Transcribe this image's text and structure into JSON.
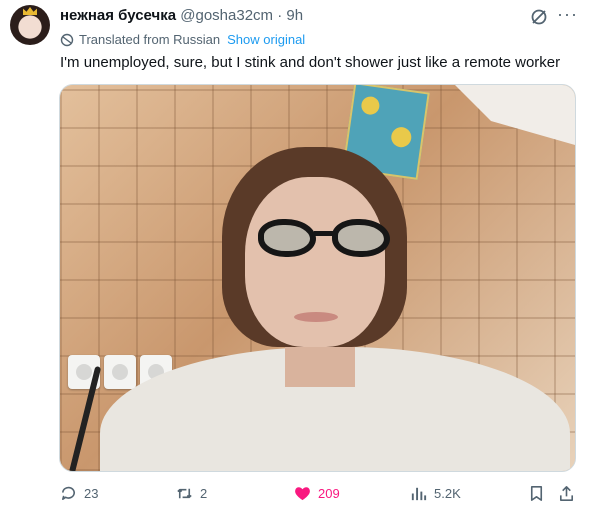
{
  "tweet": {
    "display_name": "нежная бусечка",
    "handle": "@gosha32cm",
    "separator": "·",
    "time": "9h",
    "translated_label": "Translated from Russian",
    "show_original_label": "Show original",
    "text": "I'm unemployed, sure, but I stink and don't shower just like a remote worker"
  },
  "actions": {
    "replies": "23",
    "reposts": "2",
    "likes": "209",
    "views": "5.2K"
  },
  "colors": {
    "accent": "#1d9bf0",
    "like": "#f91880",
    "secondary_text": "#536471"
  },
  "icons": [
    "grok-icon",
    "more-icon",
    "globe-icon",
    "reply-icon",
    "retweet-icon",
    "heart-icon",
    "views-icon",
    "bookmark-icon",
    "share-icon"
  ]
}
